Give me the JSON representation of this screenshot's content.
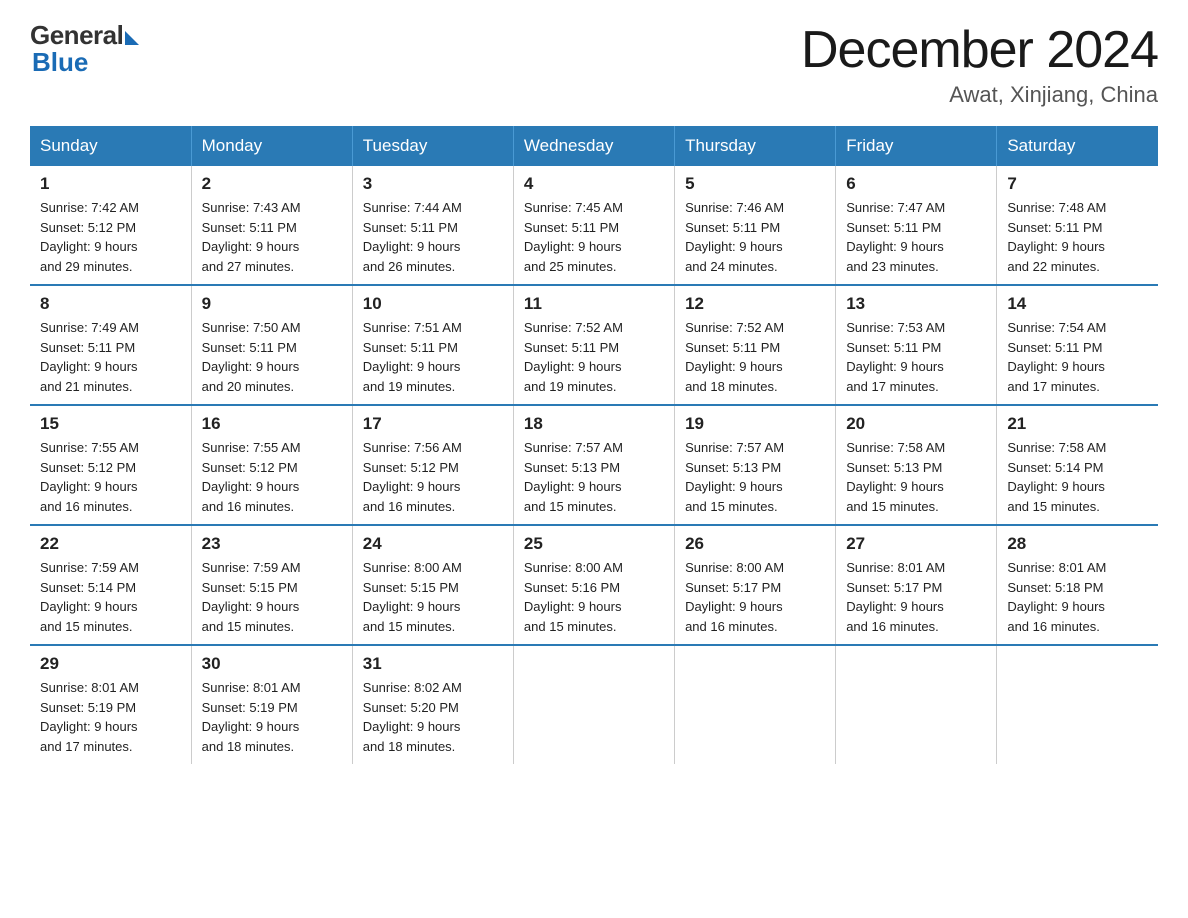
{
  "logo": {
    "general": "General",
    "blue": "Blue"
  },
  "title": "December 2024",
  "location": "Awat, Xinjiang, China",
  "days_of_week": [
    "Sunday",
    "Monday",
    "Tuesday",
    "Wednesday",
    "Thursday",
    "Friday",
    "Saturday"
  ],
  "weeks": [
    [
      {
        "day": "1",
        "info": "Sunrise: 7:42 AM\nSunset: 5:12 PM\nDaylight: 9 hours\nand 29 minutes."
      },
      {
        "day": "2",
        "info": "Sunrise: 7:43 AM\nSunset: 5:11 PM\nDaylight: 9 hours\nand 27 minutes."
      },
      {
        "day": "3",
        "info": "Sunrise: 7:44 AM\nSunset: 5:11 PM\nDaylight: 9 hours\nand 26 minutes."
      },
      {
        "day": "4",
        "info": "Sunrise: 7:45 AM\nSunset: 5:11 PM\nDaylight: 9 hours\nand 25 minutes."
      },
      {
        "day": "5",
        "info": "Sunrise: 7:46 AM\nSunset: 5:11 PM\nDaylight: 9 hours\nand 24 minutes."
      },
      {
        "day": "6",
        "info": "Sunrise: 7:47 AM\nSunset: 5:11 PM\nDaylight: 9 hours\nand 23 minutes."
      },
      {
        "day": "7",
        "info": "Sunrise: 7:48 AM\nSunset: 5:11 PM\nDaylight: 9 hours\nand 22 minutes."
      }
    ],
    [
      {
        "day": "8",
        "info": "Sunrise: 7:49 AM\nSunset: 5:11 PM\nDaylight: 9 hours\nand 21 minutes."
      },
      {
        "day": "9",
        "info": "Sunrise: 7:50 AM\nSunset: 5:11 PM\nDaylight: 9 hours\nand 20 minutes."
      },
      {
        "day": "10",
        "info": "Sunrise: 7:51 AM\nSunset: 5:11 PM\nDaylight: 9 hours\nand 19 minutes."
      },
      {
        "day": "11",
        "info": "Sunrise: 7:52 AM\nSunset: 5:11 PM\nDaylight: 9 hours\nand 19 minutes."
      },
      {
        "day": "12",
        "info": "Sunrise: 7:52 AM\nSunset: 5:11 PM\nDaylight: 9 hours\nand 18 minutes."
      },
      {
        "day": "13",
        "info": "Sunrise: 7:53 AM\nSunset: 5:11 PM\nDaylight: 9 hours\nand 17 minutes."
      },
      {
        "day": "14",
        "info": "Sunrise: 7:54 AM\nSunset: 5:11 PM\nDaylight: 9 hours\nand 17 minutes."
      }
    ],
    [
      {
        "day": "15",
        "info": "Sunrise: 7:55 AM\nSunset: 5:12 PM\nDaylight: 9 hours\nand 16 minutes."
      },
      {
        "day": "16",
        "info": "Sunrise: 7:55 AM\nSunset: 5:12 PM\nDaylight: 9 hours\nand 16 minutes."
      },
      {
        "day": "17",
        "info": "Sunrise: 7:56 AM\nSunset: 5:12 PM\nDaylight: 9 hours\nand 16 minutes."
      },
      {
        "day": "18",
        "info": "Sunrise: 7:57 AM\nSunset: 5:13 PM\nDaylight: 9 hours\nand 15 minutes."
      },
      {
        "day": "19",
        "info": "Sunrise: 7:57 AM\nSunset: 5:13 PM\nDaylight: 9 hours\nand 15 minutes."
      },
      {
        "day": "20",
        "info": "Sunrise: 7:58 AM\nSunset: 5:13 PM\nDaylight: 9 hours\nand 15 minutes."
      },
      {
        "day": "21",
        "info": "Sunrise: 7:58 AM\nSunset: 5:14 PM\nDaylight: 9 hours\nand 15 minutes."
      }
    ],
    [
      {
        "day": "22",
        "info": "Sunrise: 7:59 AM\nSunset: 5:14 PM\nDaylight: 9 hours\nand 15 minutes."
      },
      {
        "day": "23",
        "info": "Sunrise: 7:59 AM\nSunset: 5:15 PM\nDaylight: 9 hours\nand 15 minutes."
      },
      {
        "day": "24",
        "info": "Sunrise: 8:00 AM\nSunset: 5:15 PM\nDaylight: 9 hours\nand 15 minutes."
      },
      {
        "day": "25",
        "info": "Sunrise: 8:00 AM\nSunset: 5:16 PM\nDaylight: 9 hours\nand 15 minutes."
      },
      {
        "day": "26",
        "info": "Sunrise: 8:00 AM\nSunset: 5:17 PM\nDaylight: 9 hours\nand 16 minutes."
      },
      {
        "day": "27",
        "info": "Sunrise: 8:01 AM\nSunset: 5:17 PM\nDaylight: 9 hours\nand 16 minutes."
      },
      {
        "day": "28",
        "info": "Sunrise: 8:01 AM\nSunset: 5:18 PM\nDaylight: 9 hours\nand 16 minutes."
      }
    ],
    [
      {
        "day": "29",
        "info": "Sunrise: 8:01 AM\nSunset: 5:19 PM\nDaylight: 9 hours\nand 17 minutes."
      },
      {
        "day": "30",
        "info": "Sunrise: 8:01 AM\nSunset: 5:19 PM\nDaylight: 9 hours\nand 18 minutes."
      },
      {
        "day": "31",
        "info": "Sunrise: 8:02 AM\nSunset: 5:20 PM\nDaylight: 9 hours\nand 18 minutes."
      },
      {
        "day": "",
        "info": ""
      },
      {
        "day": "",
        "info": ""
      },
      {
        "day": "",
        "info": ""
      },
      {
        "day": "",
        "info": ""
      }
    ]
  ]
}
